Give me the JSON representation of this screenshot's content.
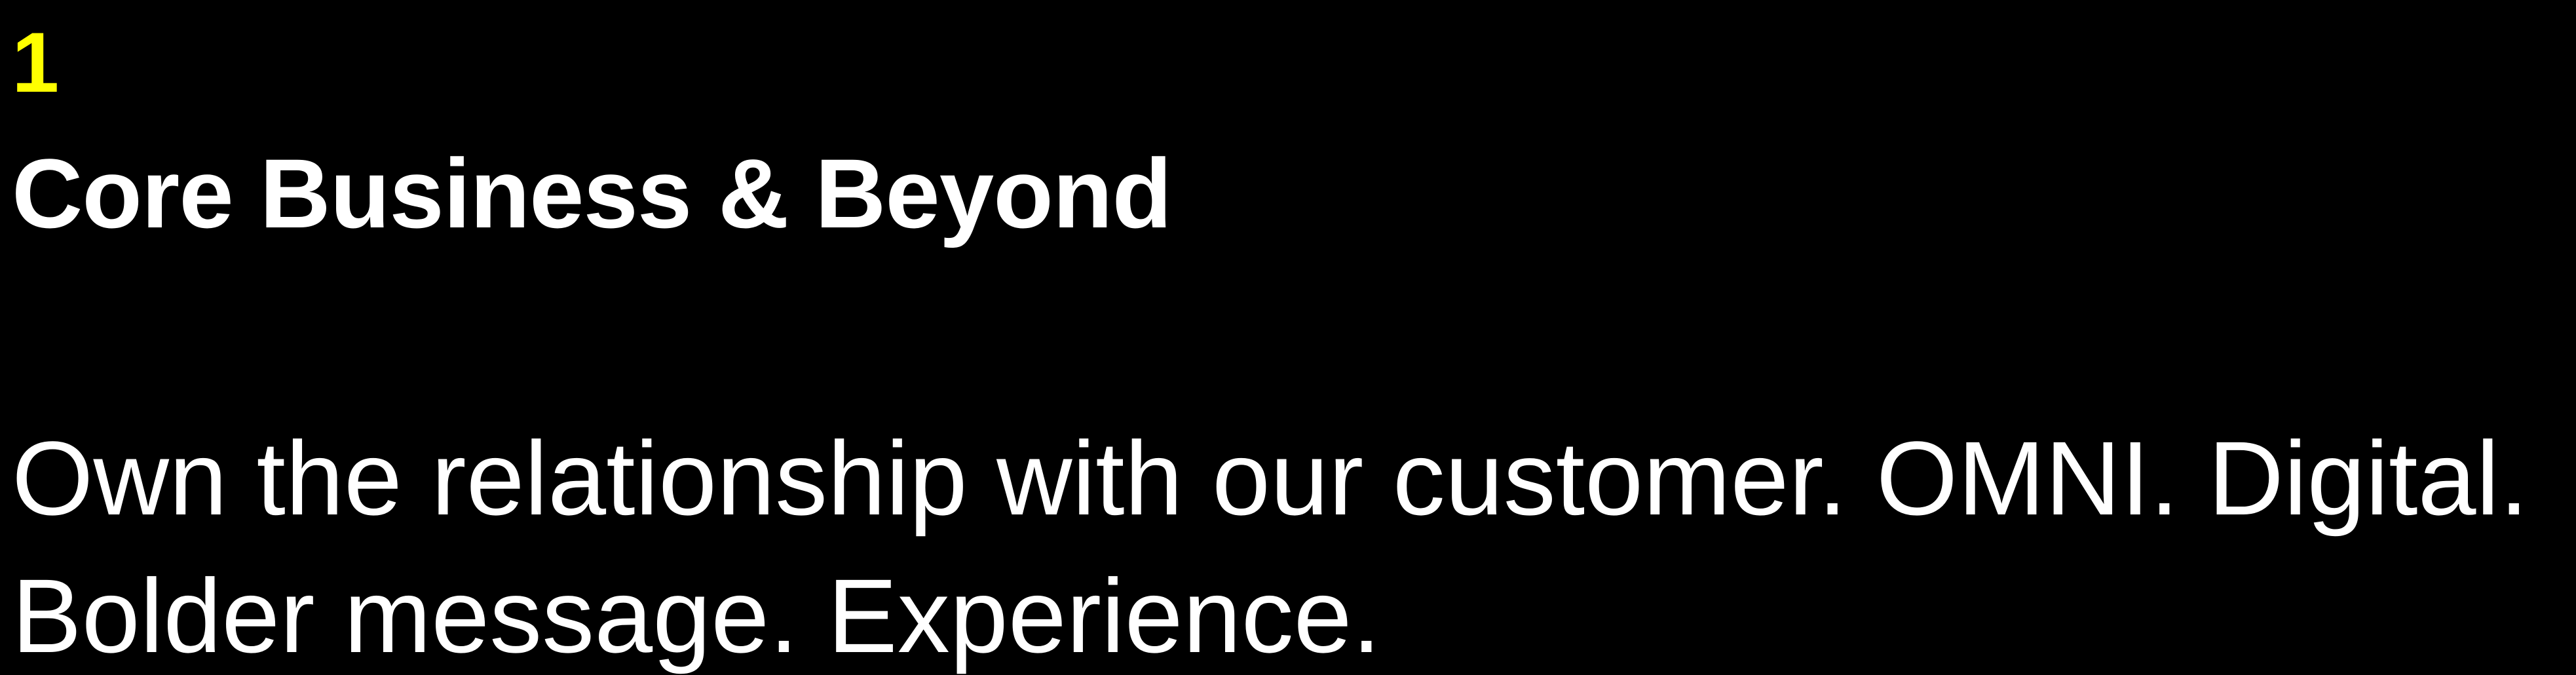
{
  "slide": {
    "section_number": "1",
    "title": "Core Business & Beyond",
    "body_lines": [
      "Own the relationship with our customer. OMNI. Digital.",
      "Bolder message. Experience."
    ]
  },
  "colors": {
    "background": "#000000",
    "accent": "#ffff00",
    "text": "#ffffff"
  }
}
